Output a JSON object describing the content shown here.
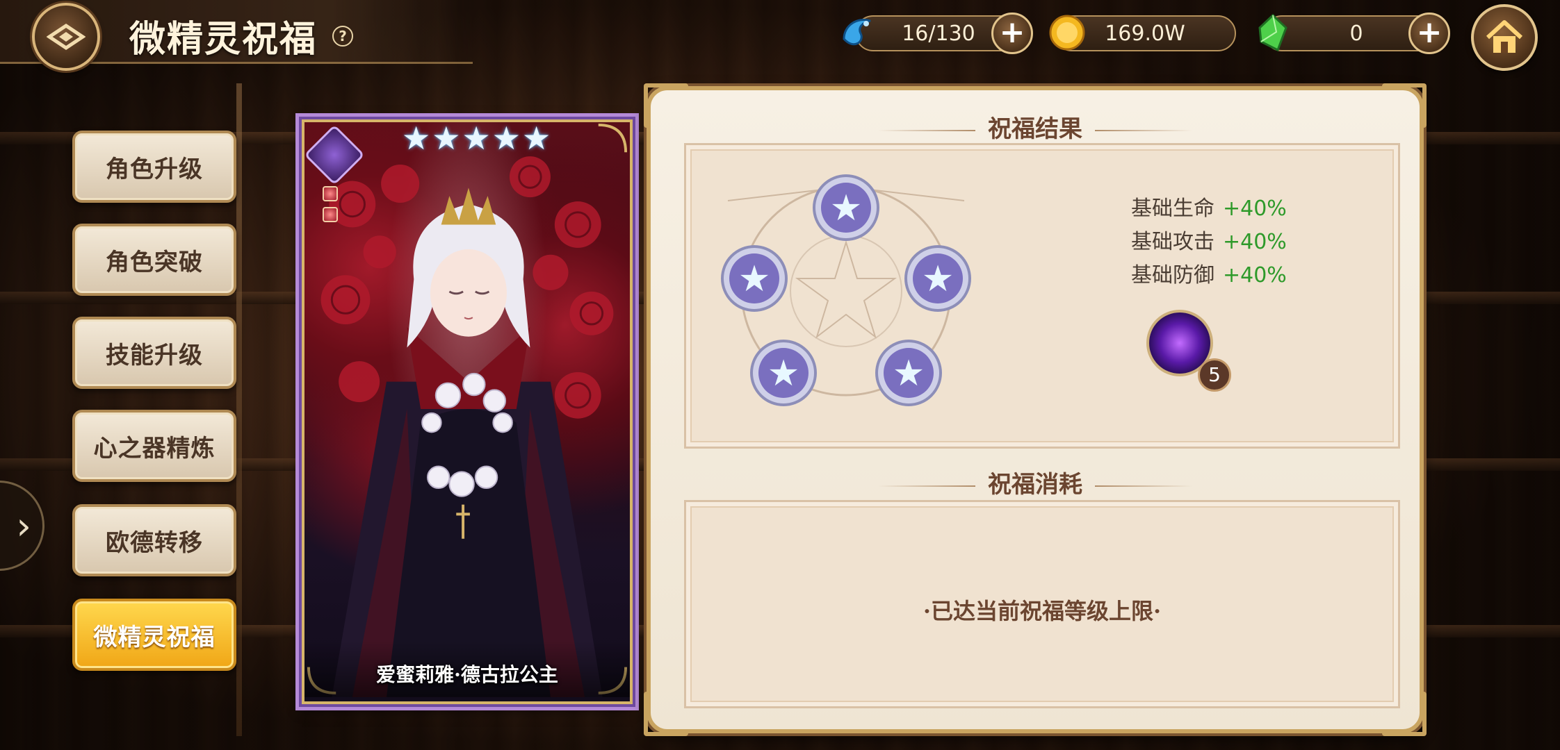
{
  "header": {
    "title": "微精灵祝福",
    "help": "?"
  },
  "currencies": [
    {
      "icon": "blue-spirit-icon",
      "value": "16/130",
      "has_plus": true
    },
    {
      "icon": "gold-coin-icon",
      "value": "169.0W",
      "has_plus": false
    },
    {
      "icon": "green-crystal-icon",
      "value": "0",
      "has_plus": true
    }
  ],
  "menu": {
    "items": [
      {
        "label": "角色升级",
        "active": false
      },
      {
        "label": "角色突破",
        "active": false
      },
      {
        "label": "技能升级",
        "active": false
      },
      {
        "label": "心之器精炼",
        "active": false
      },
      {
        "label": "欧德转移",
        "active": false
      },
      {
        "label": "微精灵祝福",
        "active": true
      }
    ]
  },
  "card": {
    "name": "爱蜜莉雅·德古拉公主",
    "stars": 5
  },
  "blessing_result": {
    "title": "祝福结果",
    "stats": [
      {
        "label": "基础生命",
        "value": "+40%"
      },
      {
        "label": "基础攻击",
        "value": "+40%"
      },
      {
        "label": "基础防御",
        "value": "+40%"
      }
    ],
    "rune_count": "5"
  },
  "blessing_cost": {
    "title": "祝福消耗",
    "message": "·已达当前祝福等级上限·"
  },
  "colors": {
    "accent_gold": "#c9a460",
    "active_menu": "#f0a616",
    "stat_green": "#2e9a2a",
    "panel_bg": "#f7f0e4"
  }
}
